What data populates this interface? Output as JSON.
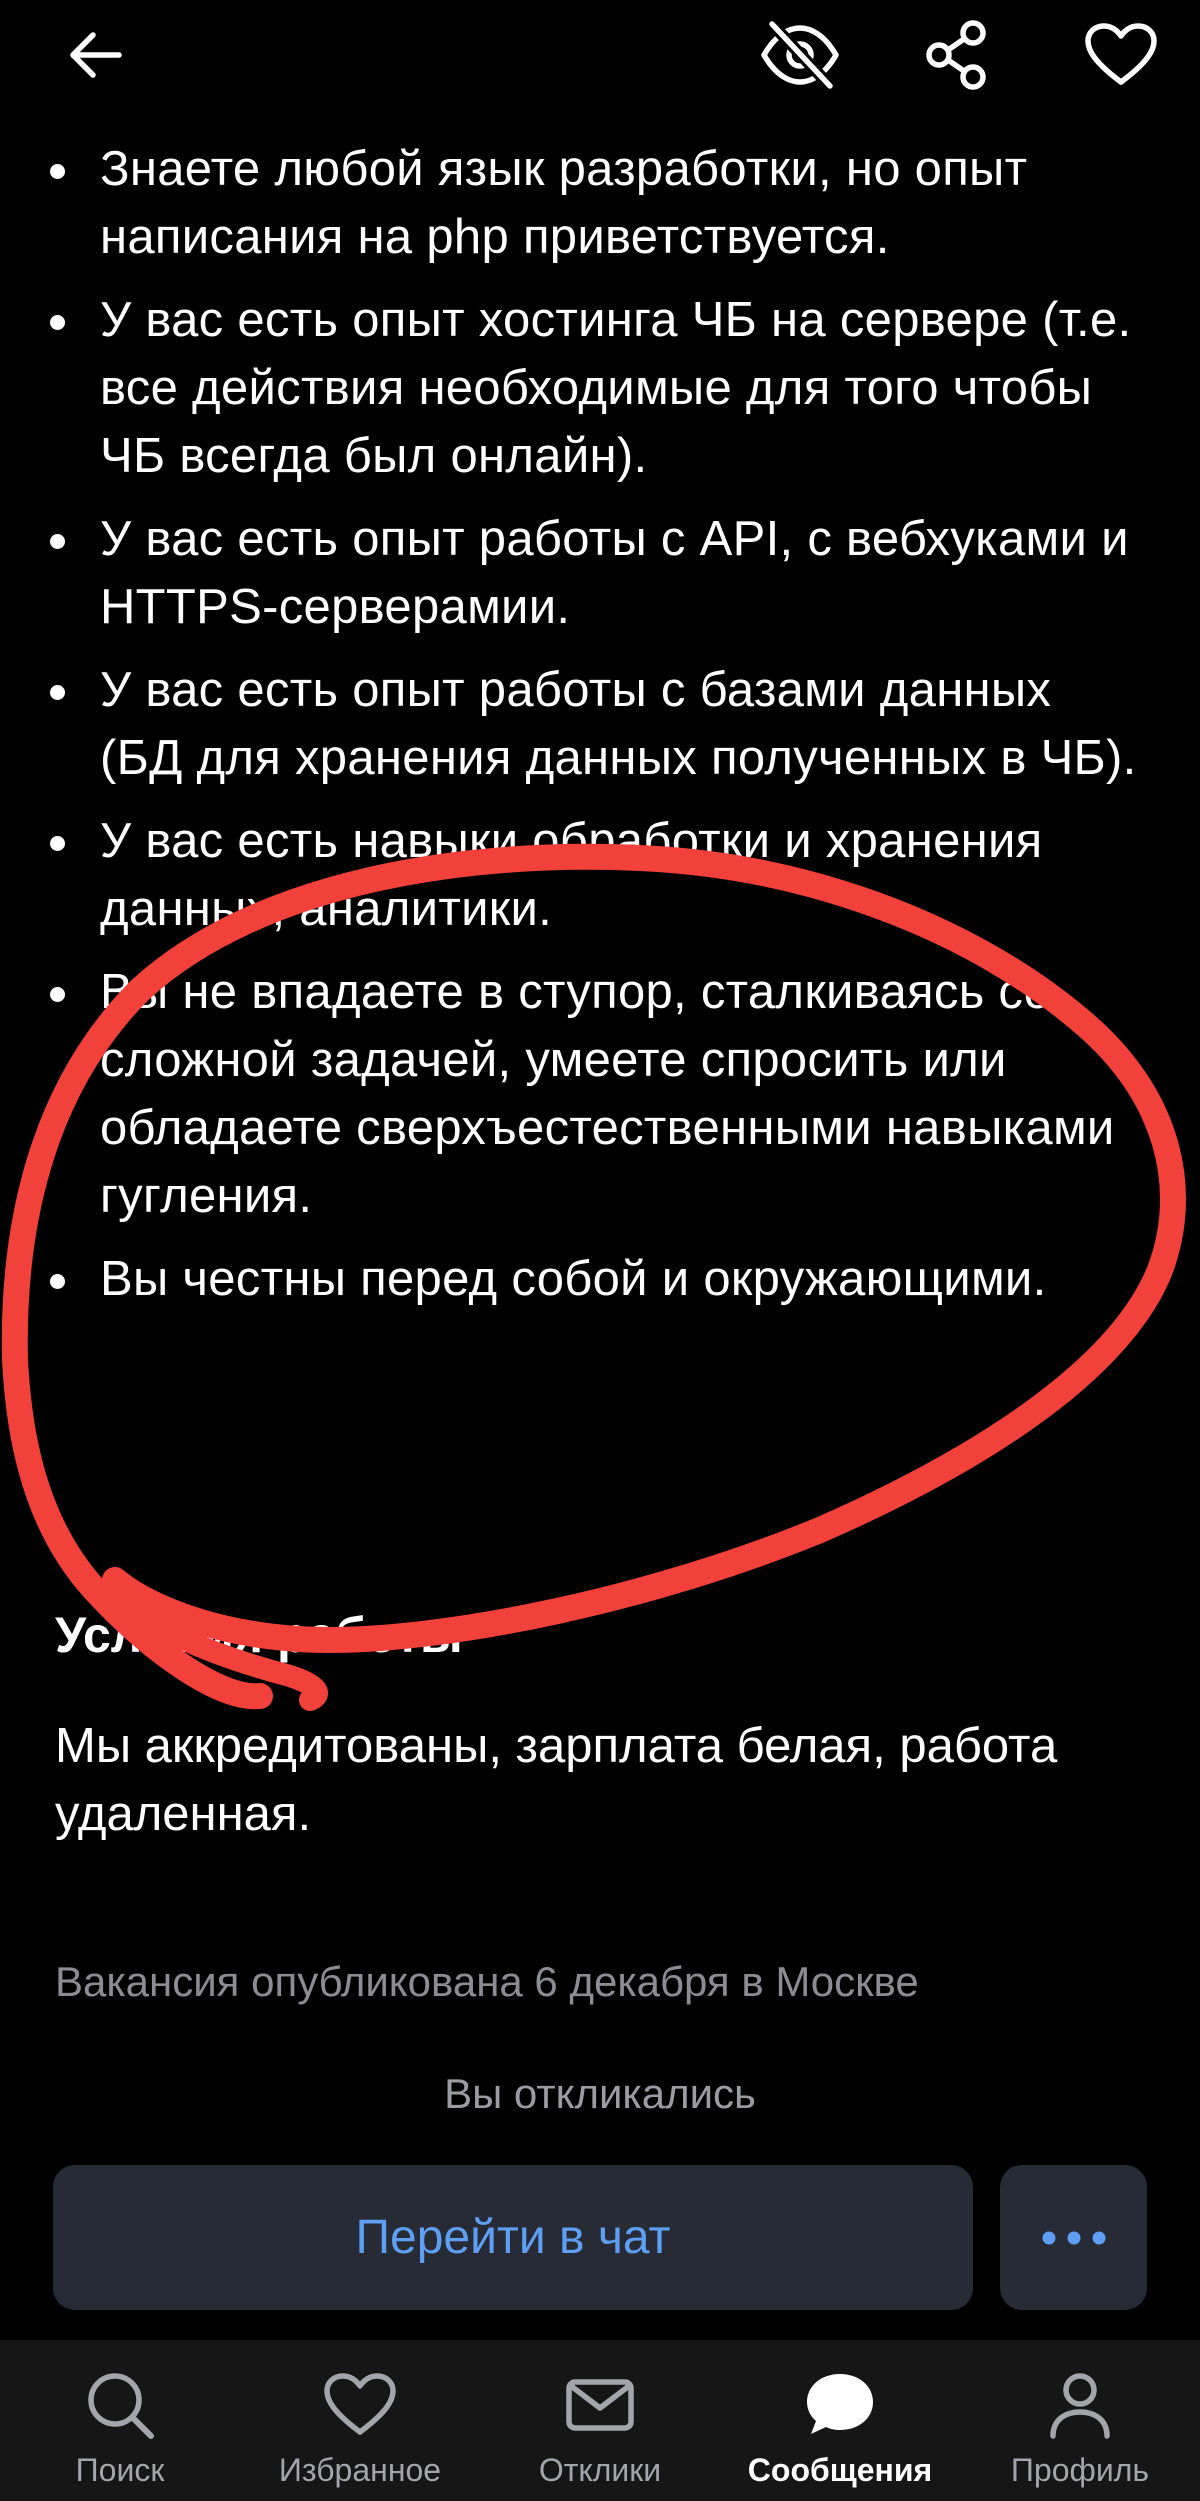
{
  "header": {
    "back_icon": "arrow-left-icon",
    "hide_icon": "eye-off-icon",
    "share_icon": "share-icon",
    "favorite_icon": "heart-icon"
  },
  "requirements": [
    "Знаете любой язык разработки, но опыт написания на php приветствуется.",
    "У вас есть опыт хостинга ЧБ на сервере (т.е. все действия необходимые для того чтобы ЧБ всегда был онлайн).",
    "У вас есть опыт работы с API, с вебхуками и HTTPS-серверамии.",
    "У вас есть опыт работы с базами данных (БД для хранения данных полученных в ЧБ).",
    "У вас есть навыки обработки и хранения данных, аналитики.",
    "Вы не впадаете в ступор, сталкиваясь со сложной задачей, умеете спросить или обладаете сверхъестественными навыками гугления.",
    "Вы честны перед собой и окружающими."
  ],
  "conditions": {
    "heading": "Условия работы",
    "text": "Мы аккредитованы, зарплата белая, работа удаленная."
  },
  "published_text": "Вакансия опубликована 6 декабря в Москве",
  "responded_text": "Вы откликались",
  "actions": {
    "chat_label": "Перейти в чат",
    "more_icon": "more-dots-icon"
  },
  "tabbar": {
    "items": [
      {
        "label": "Поиск",
        "icon": "search-icon"
      },
      {
        "label": "Избранное",
        "icon": "heart-icon"
      },
      {
        "label": "Отклики",
        "icon": "mail-icon"
      },
      {
        "label": "Сообщения",
        "icon": "chat-bubble-icon",
        "active": true
      },
      {
        "label": "Профиль",
        "icon": "profile-icon"
      }
    ]
  },
  "annotation": {
    "color": "#f2403a",
    "shape": "hand-drawn-circle"
  }
}
